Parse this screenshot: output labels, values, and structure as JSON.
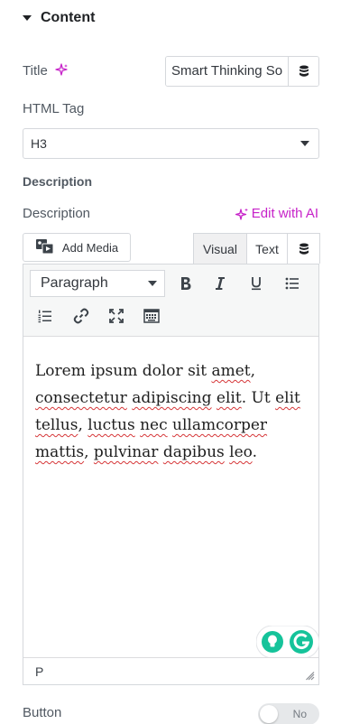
{
  "section": {
    "title": "Content"
  },
  "title_field": {
    "label": "Title",
    "value": "Smart Thinking So"
  },
  "html_tag": {
    "label": "HTML Tag",
    "value": "H3"
  },
  "description_section": {
    "heading": "Description"
  },
  "description_field": {
    "label": "Description",
    "edit_ai_label": "Edit with AI"
  },
  "editor": {
    "add_media_label": "Add Media",
    "tabs": [
      {
        "label": "Visual",
        "active": true
      },
      {
        "label": "Text",
        "active": false
      }
    ],
    "format_select": "Paragraph",
    "toolbar_icons": [
      "bold-icon",
      "italic-icon",
      "underline-icon",
      "bullet-list-icon",
      "numbered-list-icon",
      "link-icon",
      "fullscreen-icon",
      "toolbar-toggle-icon"
    ],
    "content": {
      "w1": "Lorem ipsum dolor sit ",
      "w2": "amet",
      "w3": ",",
      "w4": "consectetur",
      "w5": " ",
      "w6": "adipiscing",
      "w7": " ",
      "w8": "elit",
      "w9": ". Ut ",
      "w10": "elit",
      "w11": "tellus",
      "w12": ", ",
      "w13": "luctus",
      "w14": " ",
      "w15": "nec",
      "w16": " ",
      "w17": "ullamcorper",
      "w18": "mattis",
      "w19": ", ",
      "w20": "pulvinar",
      "w21": " ",
      "w22": "dapibus",
      "w23": " ",
      "w24": "leo",
      "w25": "."
    },
    "status_path": "P"
  },
  "button_field": {
    "label": "Button",
    "toggle_text": "No",
    "enabled": false
  },
  "colors": {
    "ai_accent": "#c723c9",
    "grammarly_green": "#15c39a"
  }
}
